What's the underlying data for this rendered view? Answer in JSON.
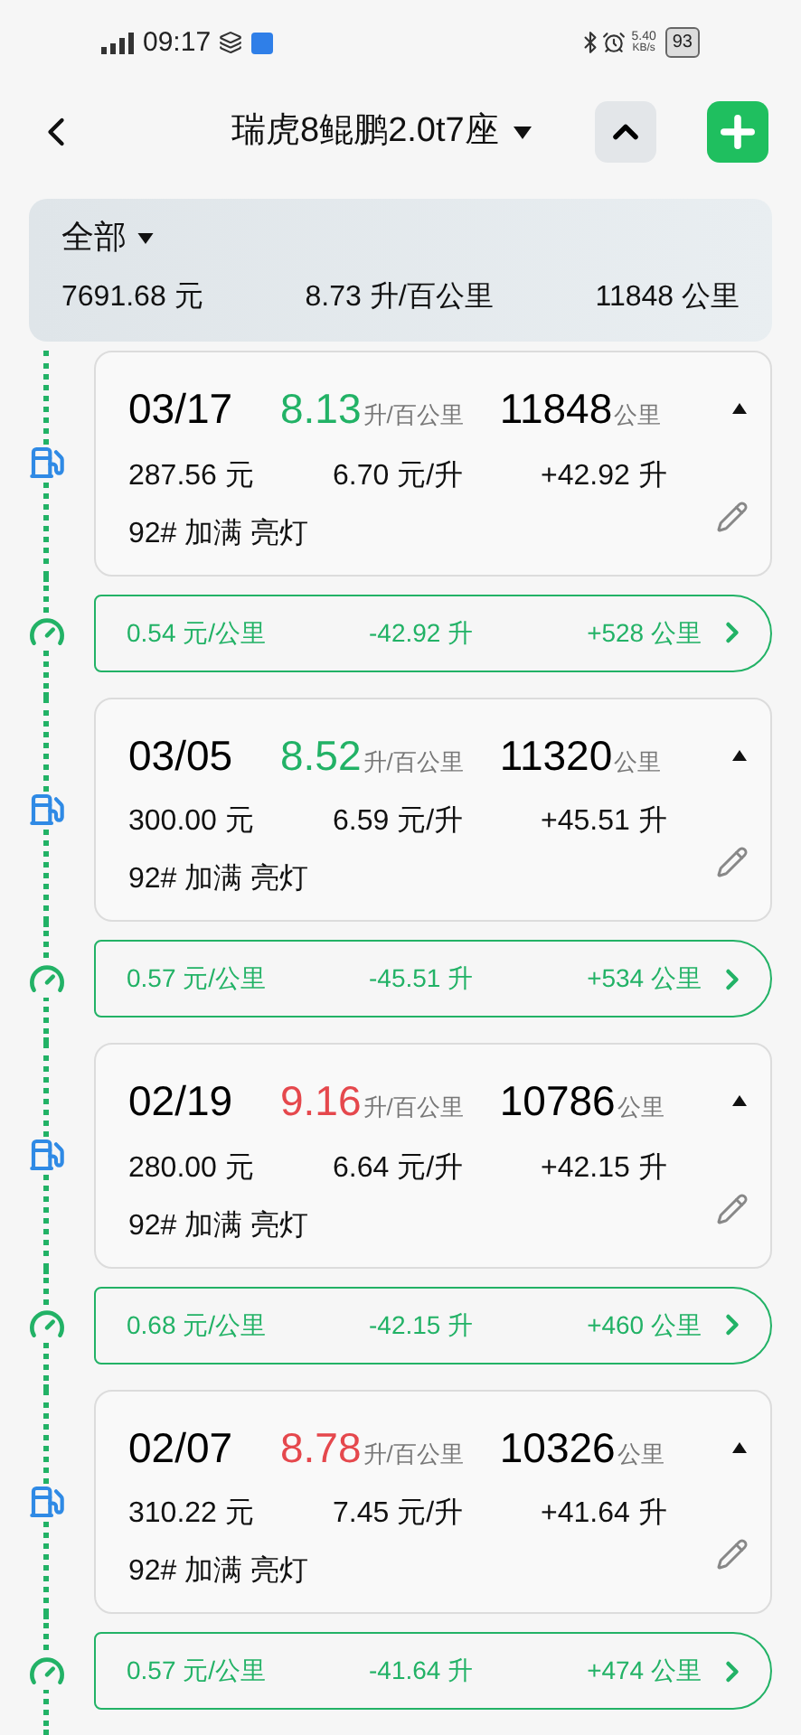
{
  "status_bar": {
    "time": "09:17",
    "speed": "5.40",
    "speed_unit": "KB/s",
    "battery": "93"
  },
  "header": {
    "title": "瑞虎8鲲鹏2.0t7座"
  },
  "summary": {
    "filter": "全部",
    "total_cost": "7691.68 元",
    "avg_consumption": "8.73 升/百公里",
    "odometer": "11848 公里"
  },
  "records": [
    {
      "date": "03/17",
      "consumption": "8.13",
      "consumption_unit": "升/百公里",
      "color": "#22b266",
      "odometer": "11848",
      "odometer_unit": "公里",
      "cost": "287.56 元",
      "price": "6.70 元/升",
      "volume": "+42.92 升",
      "note": "92# 加满 亮灯",
      "segment": {
        "cost_per_km": "0.54 元/公里",
        "used": "-42.92 升",
        "distance": "+528 公里"
      }
    },
    {
      "date": "03/05",
      "consumption": "8.52",
      "consumption_unit": "升/百公里",
      "color": "#22b266",
      "odometer": "11320",
      "odometer_unit": "公里",
      "cost": "300.00 元",
      "price": "6.59 元/升",
      "volume": "+45.51 升",
      "note": "92# 加满 亮灯",
      "segment": {
        "cost_per_km": "0.57 元/公里",
        "used": "-45.51 升",
        "distance": "+534 公里"
      }
    },
    {
      "date": "02/19",
      "consumption": "9.16",
      "consumption_unit": "升/百公里",
      "color": "#e5484d",
      "odometer": "10786",
      "odometer_unit": "公里",
      "cost": "280.00 元",
      "price": "6.64 元/升",
      "volume": "+42.15 升",
      "note": "92# 加满 亮灯",
      "segment": {
        "cost_per_km": "0.68 元/公里",
        "used": "-42.15 升",
        "distance": "+460 公里"
      }
    },
    {
      "date": "02/07",
      "consumption": "8.78",
      "consumption_unit": "升/百公里",
      "color": "#e5484d",
      "odometer": "10326",
      "odometer_unit": "公里",
      "cost": "310.22 元",
      "price": "7.45 元/升",
      "volume": "+41.64 升",
      "note": "92# 加满 亮灯",
      "segment": {
        "cost_per_km": "0.57 元/公里",
        "used": "-41.64 升",
        "distance": "+474 公里"
      }
    }
  ]
}
